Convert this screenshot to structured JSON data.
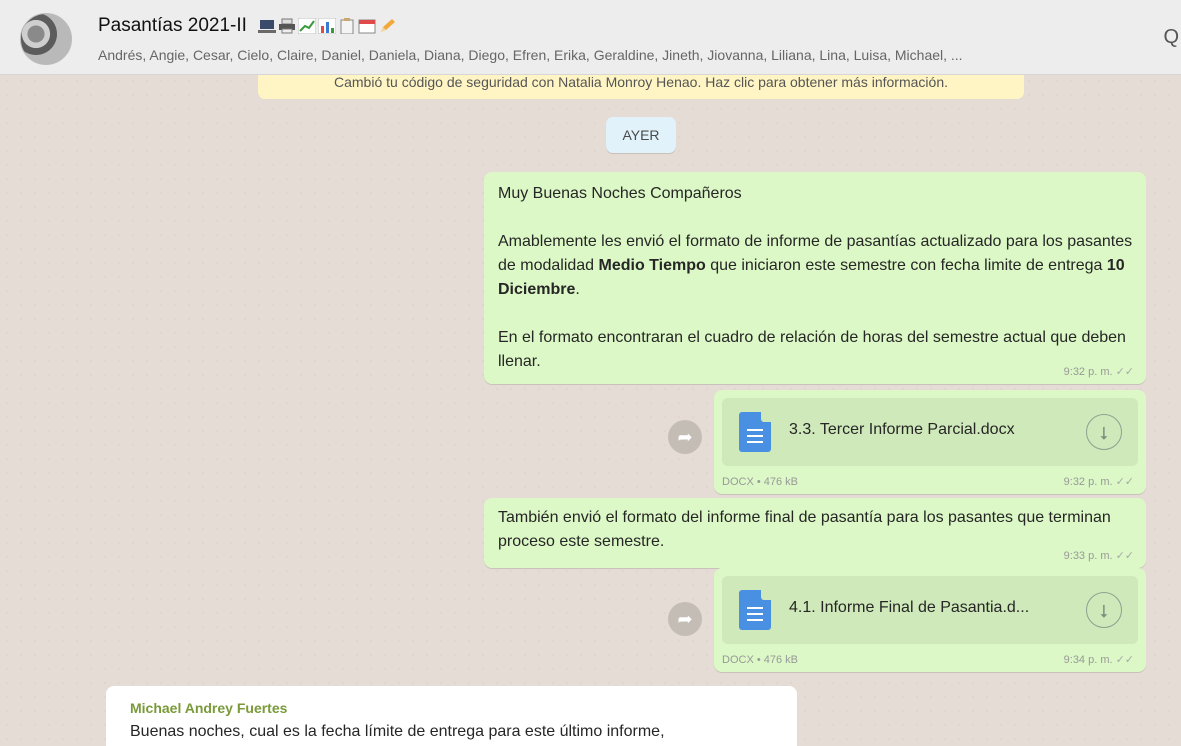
{
  "header": {
    "title": "Pasantías 2021-II",
    "title_icons": [
      "laptop-icon",
      "printer-icon",
      "trend-chart-icon",
      "bar-chart-icon",
      "clipboard-icon",
      "calendar-icon",
      "pencil-icon"
    ],
    "participants": "Andrés, Angie, Cesar, Cielo, Claire, Daniel, Daniela, Diana, Diego, Efren, Erika, Geraldine, Jineth, Jiovanna, Liliana, Lina, Luisa, Michael, ...",
    "search_glyph": "Q"
  },
  "system_notice": "Cambió tu código de seguridad con Natalia Monroy Henao. Haz clic para obtener más información.",
  "day_divider": "AYER",
  "messages": [
    {
      "greeting": "Muy Buenas Noches Compañeros",
      "p2_a": "Amablemente les envió el formato de informe de pasantías actualizado para los pasantes de modalidad ",
      "p2_b": "Medio Tiempo",
      "p2_c": " que iniciaron este semestre con fecha limite de entrega ",
      "p2_d": "10 Diciembre",
      "p2_e": ".",
      "p3": "En el formato encontraran el cuadro de relación de horas del semestre actual que deben llenar.",
      "time": "9:32 p. m."
    },
    {
      "doc_name": "3.3. Tercer Informe Parcial.docx",
      "meta": "DOCX • 476 kB",
      "time": "9:32 p. m."
    },
    {
      "text": "También envió el formato del informe final de pasantía para los pasantes que terminan proceso este semestre.",
      "time": "9:33 p. m."
    },
    {
      "doc_name": "4.1. Informe Final de Pasantia.d...",
      "meta": "DOCX • 476 kB",
      "time": "9:34 p. m."
    },
    {
      "sender": "Michael Andrey Fuertes",
      "text": "Buenas noches, cual es la fecha límite de entrega para este último informe,"
    }
  ],
  "colors": {
    "outgoing": "#dcf8c6",
    "incoming": "#ffffff",
    "background": "#e5ddd5",
    "header": "#ededed",
    "notice": "#fff5c4",
    "day": "#e1f2fb",
    "sender": "#7a9a3a"
  }
}
